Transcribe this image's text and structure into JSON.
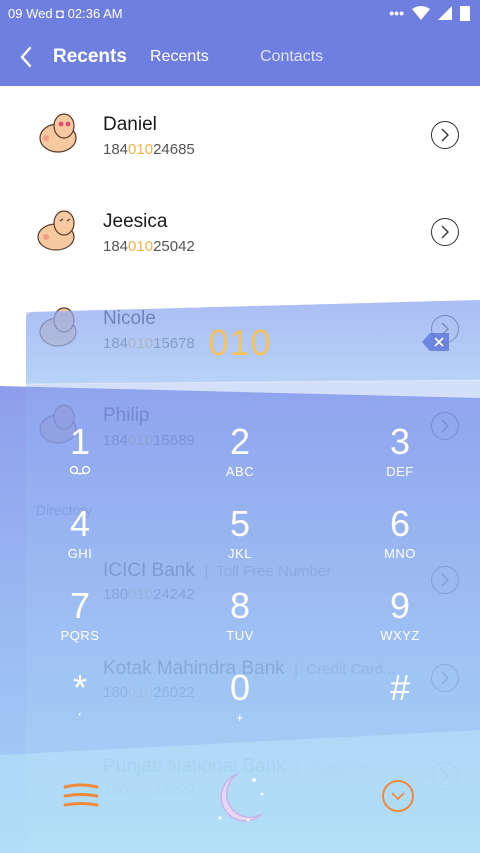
{
  "status_bar": {
    "time": "09 Wed ◘ 02:36 AM"
  },
  "header": {
    "title": "Recents",
    "tabs": [
      "Recents",
      "Contacts"
    ]
  },
  "contacts": [
    {
      "name": "Daniel",
      "num_pre": "184",
      "num_hl": "010",
      "num_post": "24685"
    },
    {
      "name": "Jeesica",
      "num_pre": "184",
      "num_hl": "010",
      "num_post": "25042"
    },
    {
      "name": "Nicole",
      "num_pre": "184",
      "num_hl": "010",
      "num_post": "15678"
    },
    {
      "name": "Philip",
      "num_pre": "184",
      "num_hl": "010",
      "num_post": "15689"
    }
  ],
  "directory_label": "Directory",
  "directory": [
    {
      "name": "ICICI Bank",
      "sub": "Toll Free Number",
      "num_pre": "180",
      "num_hl": "010",
      "num_post": "24242"
    },
    {
      "name": "Kotak Mahindra Bank",
      "sub": "Credit Card...",
      "num_pre": "180",
      "num_hl": "010",
      "num_post": "26022"
    },
    {
      "name": "Punjab National Bank",
      "sub": "Customer...",
      "num_pre": "180",
      "num_hl": "010",
      "num_post": "32222"
    }
  ],
  "dialpad": {
    "query": "010",
    "keys": [
      {
        "digit": "1",
        "letters": ""
      },
      {
        "digit": "2",
        "letters": "ABC"
      },
      {
        "digit": "3",
        "letters": "DEF"
      },
      {
        "digit": "4",
        "letters": "GHI"
      },
      {
        "digit": "5",
        "letters": "JKL"
      },
      {
        "digit": "6",
        "letters": "MNO"
      },
      {
        "digit": "7",
        "letters": "PQRS"
      },
      {
        "digit": "8",
        "letters": "TUV"
      },
      {
        "digit": "9",
        "letters": "WXYZ"
      },
      {
        "digit": "*",
        "letters": "'"
      },
      {
        "digit": "0",
        "letters": "+"
      },
      {
        "digit": "#",
        "letters": ""
      }
    ]
  },
  "colors": {
    "header": "#6f7fe0",
    "accent": "#f5c35c",
    "orange": "#f08a3a"
  }
}
